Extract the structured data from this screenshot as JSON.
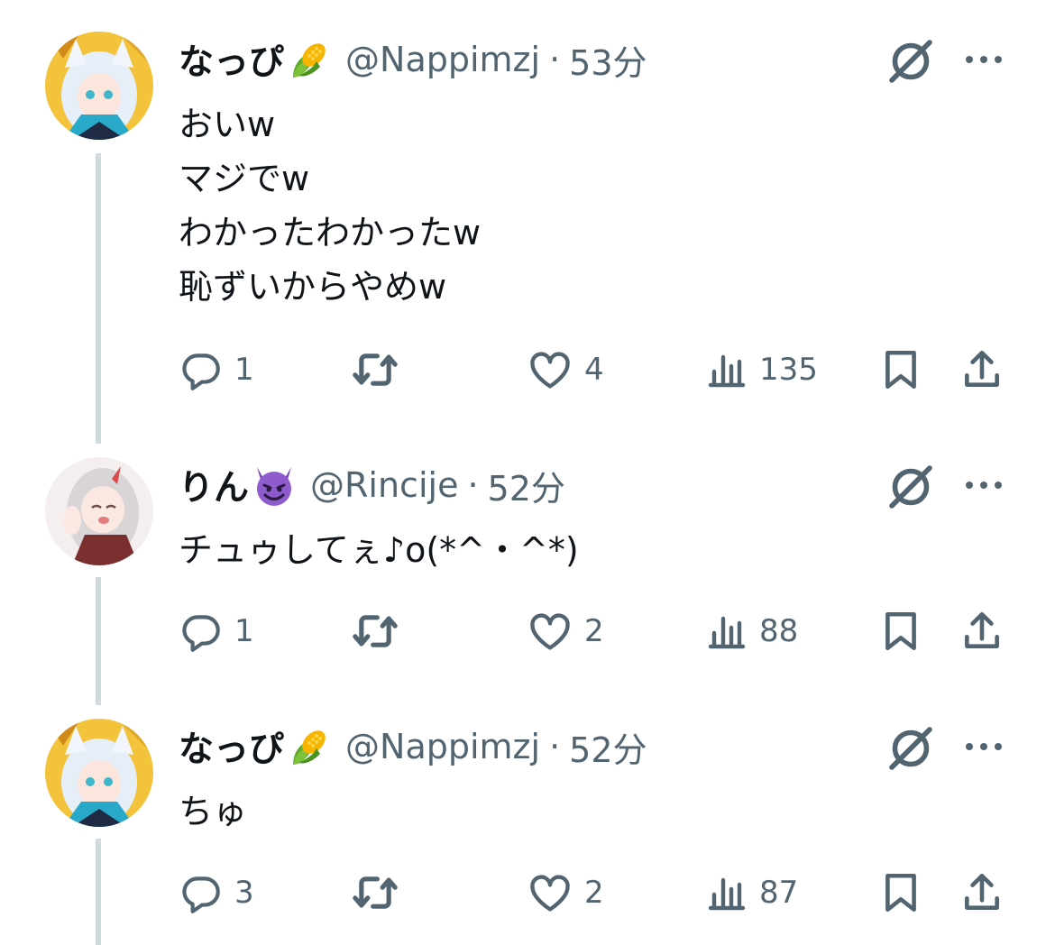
{
  "colors": {
    "text": "#0f1419",
    "secondary": "#536471",
    "thread_line": "#cfd9de"
  },
  "tweets": [
    {
      "name": "なっぴ",
      "name_emoji": "corn-emoji",
      "handle": "@Nappimzj",
      "separator": "·",
      "time": "53分",
      "lines": [
        "おいw",
        "マジでw",
        "わかったわかったw",
        "恥ずいからやめw"
      ],
      "replies": "1",
      "likes": "4",
      "views": "135"
    },
    {
      "name": "りん",
      "name_emoji": "smiling-devil-emoji",
      "handle": "@Rincije",
      "separator": "·",
      "time": "52分",
      "lines": [
        "チュゥしてぇ♪o(*^・^*)"
      ],
      "replies": "1",
      "likes": "2",
      "views": "88"
    },
    {
      "name": "なっぴ",
      "name_emoji": "corn-emoji",
      "handle": "@Nappimzj",
      "separator": "·",
      "time": "52分",
      "lines": [
        "ちゅ"
      ],
      "replies": "3",
      "likes": "2",
      "views": "87"
    }
  ]
}
